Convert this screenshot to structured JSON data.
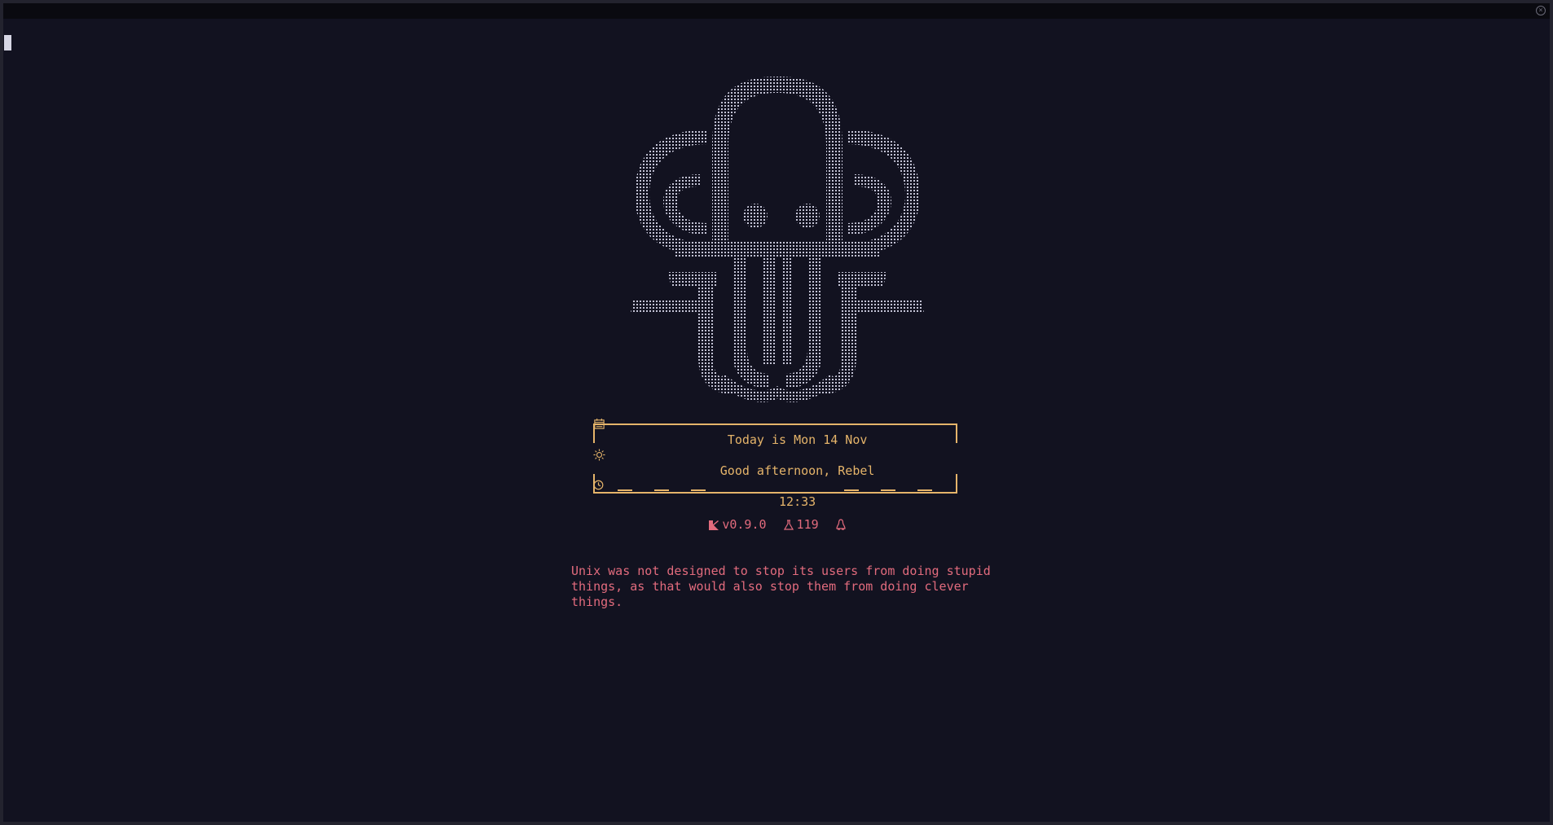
{
  "terminal": {
    "close_icon": "close-icon"
  },
  "welcome": {
    "date_line": "Today is Mon 14 Nov",
    "date_icon": "calendar-icon",
    "greeting": "Good afternoon, Rebel",
    "greeting_icon": "sun-icon",
    "time": "12:33",
    "time_icon": "clock-icon"
  },
  "status": {
    "version": "v0.9.0",
    "version_icon": "kitty-icon",
    "count": "119",
    "count_icon": "flask-icon",
    "os_icon": "tux-icon"
  },
  "quote": {
    "text": "Unix was not designed to stop its users from doing stupid\nthings, as that would also stop them from doing clever\nthings."
  },
  "colors": {
    "background": "#121220",
    "accent_gold": "#e5b46a",
    "accent_pink": "#e26b7d",
    "art": "#c4c4d6"
  }
}
